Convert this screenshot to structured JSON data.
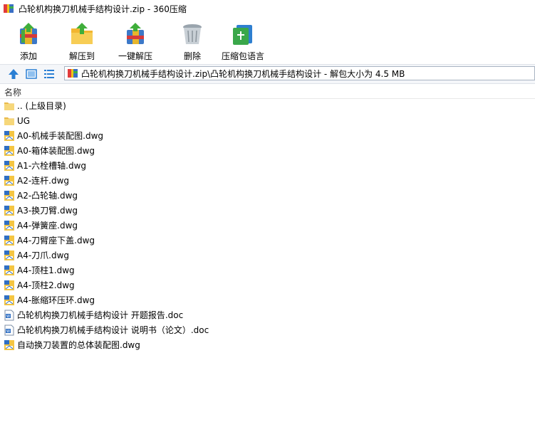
{
  "window": {
    "title": "凸轮机构换刀机械手结构设计.zip - 360压缩"
  },
  "toolbar": {
    "items": [
      {
        "label": "添加",
        "icon": "add-archive-icon"
      },
      {
        "label": "解压到",
        "icon": "extract-to-icon"
      },
      {
        "label": "一键解压",
        "icon": "one-click-extract-icon"
      },
      {
        "label": "删除",
        "icon": "trash-icon"
      },
      {
        "label": "压缩包语言",
        "icon": "encoding-language-icon"
      }
    ]
  },
  "address": {
    "path": "凸轮机构换刀机械手结构设计.zip\\凸轮机构换刀机械手结构设计 - 解包大小为 4.5 MB"
  },
  "list": {
    "column_name": "名称",
    "files": [
      {
        "name": ".. (上级目录)",
        "type": "folder"
      },
      {
        "name": "UG",
        "type": "folder"
      },
      {
        "name": "A0-机械手装配图.dwg",
        "type": "dwg"
      },
      {
        "name": "A0-箱体装配图.dwg",
        "type": "dwg"
      },
      {
        "name": "A1-六栓槽轴.dwg",
        "type": "dwg"
      },
      {
        "name": "A2-连杆.dwg",
        "type": "dwg"
      },
      {
        "name": "A2-凸轮轴.dwg",
        "type": "dwg"
      },
      {
        "name": "A3-换刀臂.dwg",
        "type": "dwg"
      },
      {
        "name": "A4-弹簧座.dwg",
        "type": "dwg"
      },
      {
        "name": "A4-刀臂座下盖.dwg",
        "type": "dwg"
      },
      {
        "name": "A4-刀爪.dwg",
        "type": "dwg"
      },
      {
        "name": "A4-顶柱1.dwg",
        "type": "dwg"
      },
      {
        "name": "A4-顶柱2.dwg",
        "type": "dwg"
      },
      {
        "name": "A4-胀缩环压环.dwg",
        "type": "dwg"
      },
      {
        "name": "凸轮机构换刀机械手结构设计 开题报告.doc",
        "type": "doc"
      },
      {
        "name": "凸轮机构换刀机械手结构设计 说明书（论文）.doc",
        "type": "doc"
      },
      {
        "name": "自动换刀装置的总体装配图.dwg",
        "type": "dwg"
      }
    ]
  },
  "colors": {
    "accent": "#2a7fd4",
    "folder": "#f6d77a"
  }
}
